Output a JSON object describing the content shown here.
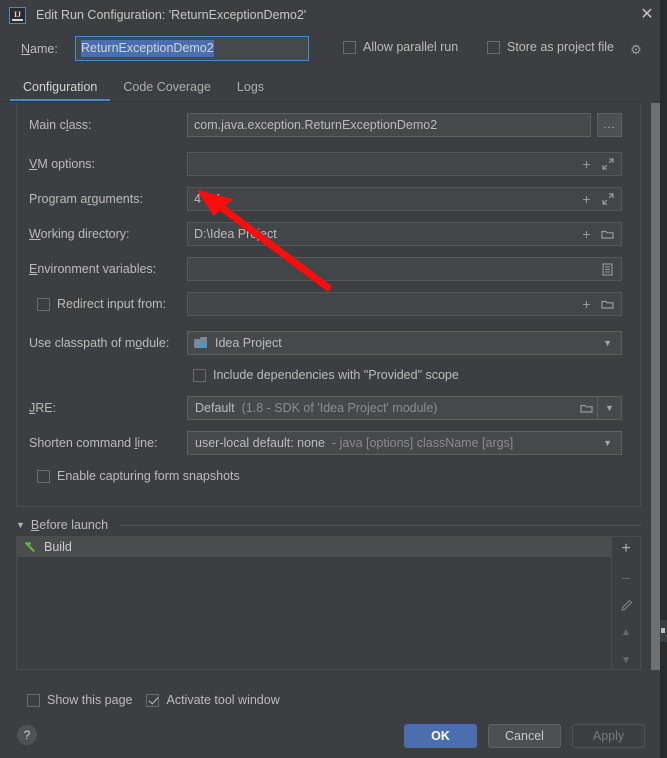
{
  "window": {
    "title": "Edit Run Configuration: 'ReturnExceptionDemo2'",
    "logo_text": "IJ",
    "close_icon": "close-icon"
  },
  "name_row": {
    "label": "Name:",
    "value": "ReturnExceptionDemo2",
    "allow_parallel_run": {
      "label": "Allow parallel run",
      "checked": false
    },
    "store_as_project_file": {
      "label": "Store as project file",
      "checked": false
    },
    "gear_icon": "gear-icon"
  },
  "tabs": [
    {
      "label": "Configuration",
      "active": true
    },
    {
      "label": "Code Coverage",
      "active": false
    },
    {
      "label": "Logs",
      "active": false
    }
  ],
  "configuration": {
    "main_class": {
      "label": "Main class:",
      "value": "com.java.exception.ReturnExceptionDemo2",
      "browse_label": "..."
    },
    "vm_options": {
      "label": "VM options:",
      "value": "",
      "icons": [
        "plus-icon",
        "expand-icon"
      ]
    },
    "program_arguments": {
      "label": "Program arguments:",
      "value": "4 4 1",
      "icons": [
        "plus-icon",
        "expand-icon"
      ]
    },
    "working_directory": {
      "label": "Working directory:",
      "value": "D:\\Idea Project",
      "icons": [
        "plus-icon",
        "folder-icon"
      ]
    },
    "environment_variables": {
      "label": "Environment variables:",
      "value": "",
      "icons": [
        "list-icon"
      ]
    },
    "redirect_input": {
      "label": "Redirect input from:",
      "checked": false,
      "value": "",
      "icons": [
        "plus-icon",
        "folder-icon"
      ]
    },
    "use_classpath_of_module": {
      "label": "Use classpath of module:",
      "value": "Idea Project",
      "module_icon": "module-icon"
    },
    "include_provided": {
      "label": "Include dependencies with \"Provided\" scope",
      "checked": false
    },
    "jre": {
      "label": "JRE:",
      "value": "Default",
      "detail": "(1.8 - SDK of 'Idea Project' module)",
      "icons": [
        "folder-icon",
        "chevron-down-icon"
      ]
    },
    "shorten_command_line": {
      "label": "Shorten command line:",
      "value": "user-local default: none",
      "detail": "- java [options] className [args]"
    },
    "enable_capturing": {
      "label": "Enable capturing form snapshots",
      "checked": false
    }
  },
  "before_launch": {
    "title": "Before launch",
    "caret_icon": "chevron-down-icon",
    "items": [
      {
        "label": "Build",
        "icon": "hammer-icon"
      }
    ],
    "toolbar": [
      {
        "name": "add-button",
        "glyph": "+",
        "enabled": true
      },
      {
        "name": "remove-button",
        "glyph": "–",
        "enabled": false
      },
      {
        "name": "edit-button",
        "glyph": "pencil-icon",
        "enabled": false
      },
      {
        "name": "move-up-button",
        "glyph": "▲",
        "enabled": false
      },
      {
        "name": "move-down-button",
        "glyph": "▼",
        "enabled": false
      }
    ]
  },
  "bottom_options": {
    "show_this_page": {
      "label": "Show this page",
      "checked": false
    },
    "activate_tool_window": {
      "label": "Activate tool window",
      "checked": true
    }
  },
  "footer": {
    "help_label": "?",
    "ok_label": "OK",
    "cancel_label": "Cancel",
    "apply_label": "Apply"
  },
  "annotation": {
    "type": "red-arrow",
    "points_to": "program-arguments-field"
  },
  "colors": {
    "dialog_bg": "#3c3f41",
    "field_bg": "#45494a",
    "accent_blue": "#4a88c7",
    "selection_blue": "#4b6eaf",
    "ok_button": "#4c6eaf",
    "text": "#bbbbbb",
    "annotation_red": "#ff0000"
  }
}
